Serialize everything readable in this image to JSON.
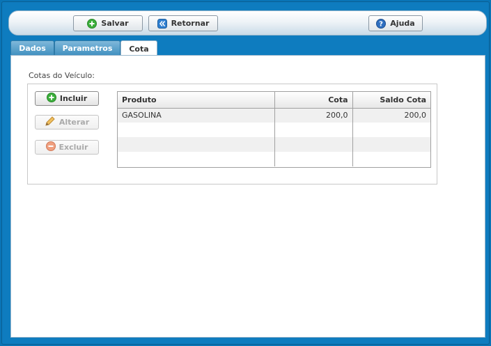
{
  "toolbar": {
    "save_label": "Salvar",
    "return_label": "Retornar",
    "help_label": "Ajuda"
  },
  "tabs": [
    {
      "label": "Dados"
    },
    {
      "label": "Parametros"
    },
    {
      "label": "Cota"
    }
  ],
  "section": {
    "label": "Cotas do Veículo:"
  },
  "actions": {
    "include_label": "Incluir",
    "edit_label": "Alterar",
    "delete_label": "Excluir"
  },
  "grid": {
    "headers": [
      "Produto",
      "Cota",
      "Saldo Cota"
    ],
    "rows": [
      [
        "GASOLINA",
        "200,0",
        "200,0"
      ]
    ]
  },
  "colors": {
    "frame": "#0e7cbf",
    "tab_active": "#ffffff",
    "tab_inactive": "#3f8fbf"
  }
}
